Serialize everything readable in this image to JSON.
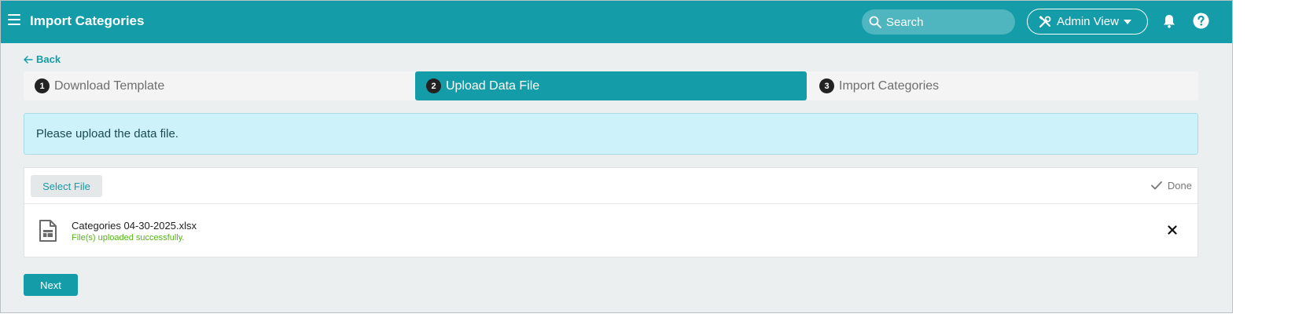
{
  "header": {
    "title": "Import Categories",
    "search_placeholder": "Search",
    "view_label": "Admin View",
    "icons": [
      "menu-icon",
      "search-icon",
      "tools-icon",
      "chevron-down-icon",
      "bell-icon",
      "help-icon"
    ]
  },
  "nav": {
    "back_label": "Back"
  },
  "steps": [
    {
      "number": "1",
      "label": "Download Template",
      "active": false
    },
    {
      "number": "2",
      "label": "Upload Data File",
      "active": true
    },
    {
      "number": "3",
      "label": "Import Categories",
      "active": false
    }
  ],
  "info_message": "Please upload the data file.",
  "upload": {
    "select_label": "Select File",
    "status_label": "Done",
    "file": {
      "name": "Categories 04-30-2025.xlsx",
      "status": "File(s) uploaded successfully."
    }
  },
  "actions": {
    "next_label": "Next"
  },
  "colors": {
    "primary": "#149ca8",
    "info_bg": "#cdf2fa",
    "success": "#55b518",
    "page_bg": "#eceff0"
  }
}
